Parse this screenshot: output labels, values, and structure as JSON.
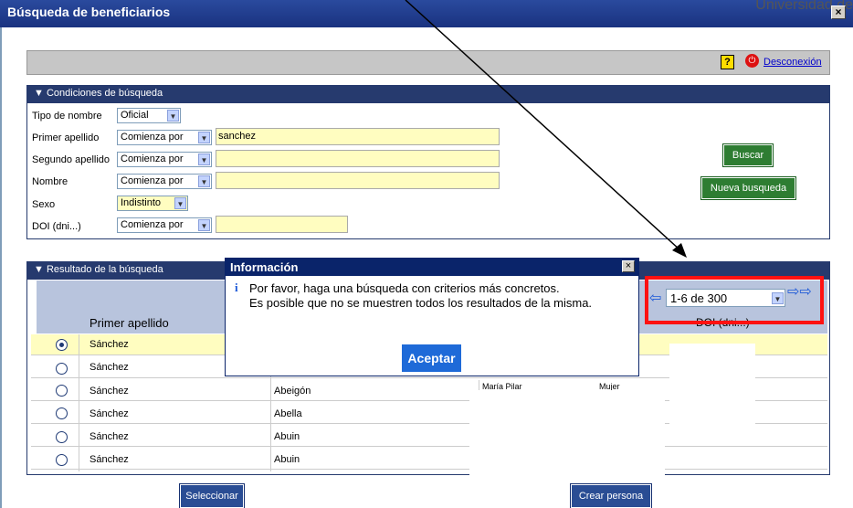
{
  "window": {
    "title": "Búsqueda de beneficiarios",
    "close": "×",
    "bg_text": "Universidad de"
  },
  "toolbar": {
    "help": "?",
    "logout": "Desconexión"
  },
  "search": {
    "header": "Condiciones de búsqueda",
    "tipo_label": "Tipo de nombre",
    "tipo_value": "Oficial",
    "apellido1_label": "Primer apellido",
    "apellido1_mode": "Comienza por",
    "apellido1_value": "sanchez",
    "apellido2_label": "Segundo apellido",
    "apellido2_mode": "Comienza por",
    "nombre_label": "Nombre",
    "nombre_mode": "Comienza por",
    "sexo_label": "Sexo",
    "sexo_value": "Indistinto",
    "doi_label": "DOI (dni...)",
    "doi_mode": "Comienza por",
    "buscar": "Buscar",
    "nueva": "Nueva busqueda"
  },
  "results": {
    "header": "Resultado de la búsqueda",
    "col1": "Primer apellido",
    "col_doi": "DOI (dni...)",
    "pager": "1-6 de 300",
    "rows": [
      {
        "a1": "Sánchez",
        "a2": "",
        "n": "",
        "s": ""
      },
      {
        "a1": "Sánchez",
        "a2": "",
        "n": "",
        "s": ""
      },
      {
        "a1": "Sánchez",
        "a2": "Abeigón",
        "n": "María Pilar",
        "s": "Mujer"
      },
      {
        "a1": "Sánchez",
        "a2": "Abella",
        "n": "",
        "s": ""
      },
      {
        "a1": "Sánchez",
        "a2": "Abuin",
        "n": "",
        "s": ""
      },
      {
        "a1": "Sánchez",
        "a2": "Abuin",
        "n": "",
        "s": ""
      }
    ],
    "seleccionar": "Seleccionar",
    "crear": "Crear persona"
  },
  "dialog": {
    "title": "Información",
    "icon": "i",
    "line1": "Por favor, haga una búsqueda con criterios más concretos.",
    "line2": "Es posible que no se muestren todos los resultados de la misma.",
    "ok": "Aceptar"
  },
  "colors": {
    "accent": "#263a6e",
    "highlight": "#ff1111",
    "input_bg": "#fffdc0"
  }
}
